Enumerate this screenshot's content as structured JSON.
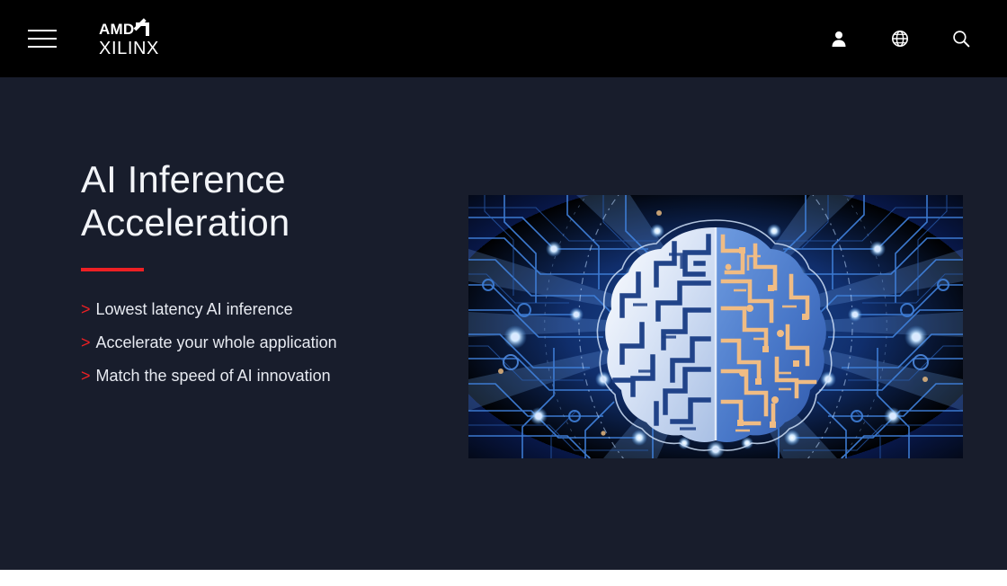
{
  "header": {
    "menu_label": "Menu",
    "logo": {
      "amd_text": "AMD",
      "xilinx_text": "XILINX"
    },
    "icons": [
      {
        "name": "account-icon",
        "label": "Account"
      },
      {
        "name": "language-icon",
        "label": "Language"
      },
      {
        "name": "search-icon",
        "label": "Search"
      }
    ]
  },
  "hero": {
    "title": "AI Inference\nAcceleration",
    "accent_color": "#ed2024",
    "background_color": "#181d2c",
    "bullet_marker": ">",
    "bullets": [
      {
        "text": "Lowest latency AI inference"
      },
      {
        "text": "Accelerate your whole application"
      },
      {
        "text": "Match the speed of AI innovation"
      }
    ],
    "image": {
      "name": "ai-brain-circuit-board-image",
      "alt": "Digital brain rendered as a circuit board, left hemisphere in light blue maze traces and right hemisphere in orange circuit traces, on a glowing blue printed-circuit background",
      "colors": {
        "background_dark": "#050a1a",
        "circuit_blue": "#2a5fb4",
        "glow_blue": "#7fc4ff",
        "brain_left": "#d6e2f5",
        "brain_right": "#f0bc84",
        "brain_body": "#4a7fd4"
      }
    }
  }
}
